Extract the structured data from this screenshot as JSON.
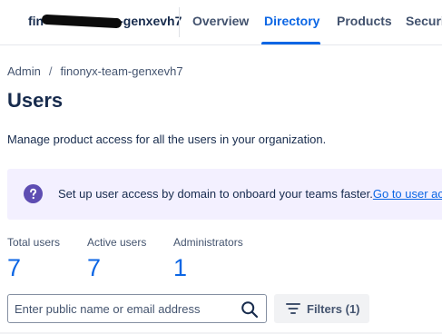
{
  "nav": {
    "org_prefix": "fin",
    "org_suffix": "-genxevh7",
    "tabs": [
      {
        "label": "Overview"
      },
      {
        "label": "Directory"
      },
      {
        "label": "Products"
      },
      {
        "label": "Security"
      }
    ],
    "active_tab": "Directory"
  },
  "breadcrumb": {
    "root": "Admin",
    "separator": "/",
    "current": "finonyx-team-genxevh7"
  },
  "page": {
    "title": "Users",
    "description": "Manage product access for all the users in your organization."
  },
  "banner": {
    "icon": "question-circle-icon",
    "text": "Set up user access by domain to onboard your teams faster.",
    "link": "Go to user access settings"
  },
  "stats": [
    {
      "label": "Total users",
      "value": "7"
    },
    {
      "label": "Active users",
      "value": "7"
    },
    {
      "label": "Administrators",
      "value": "1"
    }
  ],
  "search": {
    "placeholder": "Enter public name or email address",
    "value": "",
    "icon": "search-icon"
  },
  "filters": {
    "label": "Filters (1)",
    "icon": "filter-icon"
  },
  "colors": {
    "accent": "#0c66e4",
    "banner_bg": "#f3f0ff",
    "banner_icon": "#5e4db2",
    "text": "#172b4d",
    "subtle_text": "#44546f"
  }
}
